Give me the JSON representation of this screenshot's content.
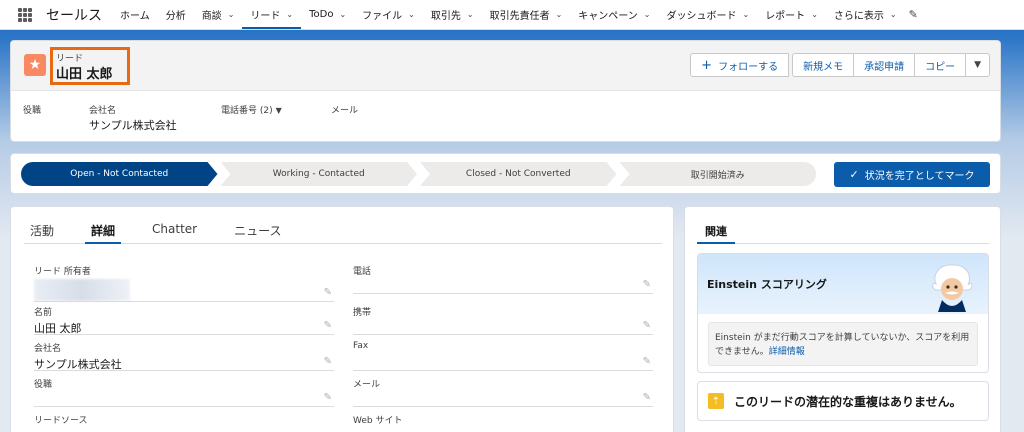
{
  "nav": {
    "app_name": "セールス",
    "items": [
      {
        "label": "ホーム",
        "chevron": false
      },
      {
        "label": "分析",
        "chevron": false
      },
      {
        "label": "商談",
        "chevron": true
      },
      {
        "label": "リード",
        "chevron": true,
        "active": true
      },
      {
        "label": "ToDo",
        "chevron": true
      },
      {
        "label": "ファイル",
        "chevron": true
      },
      {
        "label": "取引先",
        "chevron": true
      },
      {
        "label": "取引先責任者",
        "chevron": true
      },
      {
        "label": "キャンペーン",
        "chevron": true
      },
      {
        "label": "ダッシュボード",
        "chevron": true
      },
      {
        "label": "レポート",
        "chevron": true
      },
      {
        "label": "さらに表示",
        "chevron": true
      }
    ]
  },
  "record": {
    "type": "リード",
    "name": "山田 太郎",
    "buttons": {
      "follow": "フォローする",
      "new_note": "新規メモ",
      "approval": "承認申請",
      "copy": "コピー"
    },
    "highlights": {
      "title_label": "役職",
      "company_label": "会社名",
      "company_value": "サンプル株式会社",
      "phone_label": "電話番号 (2)",
      "email_label": "メール"
    }
  },
  "path": {
    "stages": [
      "Open - Not Contacted",
      "Working - Contacted",
      "Closed - Not Converted",
      "取引開始済み"
    ],
    "current": 0,
    "mark_complete": "状況を完了としてマーク"
  },
  "detail": {
    "tabs": [
      "活動",
      "詳細",
      "Chatter",
      "ニュース"
    ],
    "active_tab": 1,
    "fields": {
      "owner_label": "リード 所有者",
      "phone_label": "電話",
      "name_label": "名前",
      "name_value": "山田 太郎",
      "mobile_label": "携帯",
      "company_label": "会社名",
      "company_value": "サンプル株式会社",
      "fax_label": "Fax",
      "title_label": "役職",
      "email_label": "メール",
      "source_label": "リードソース",
      "website_label": "Web サイト"
    }
  },
  "related": {
    "tab": "関連",
    "einstein_title": "Einstein スコアリング",
    "einstein_message": "Einstein がまだ行動スコアを計算していないか、スコアを利用できません。",
    "einstein_link": "詳細情報",
    "duplicates": "このリードの潜在的な重複はありません。"
  },
  "colors": {
    "brand_blue": "#0b5cab",
    "path_active": "#014486",
    "lead_icon": "#f88962",
    "highlight_box": "#e56a12",
    "warning_icon": "#f4bc25"
  }
}
